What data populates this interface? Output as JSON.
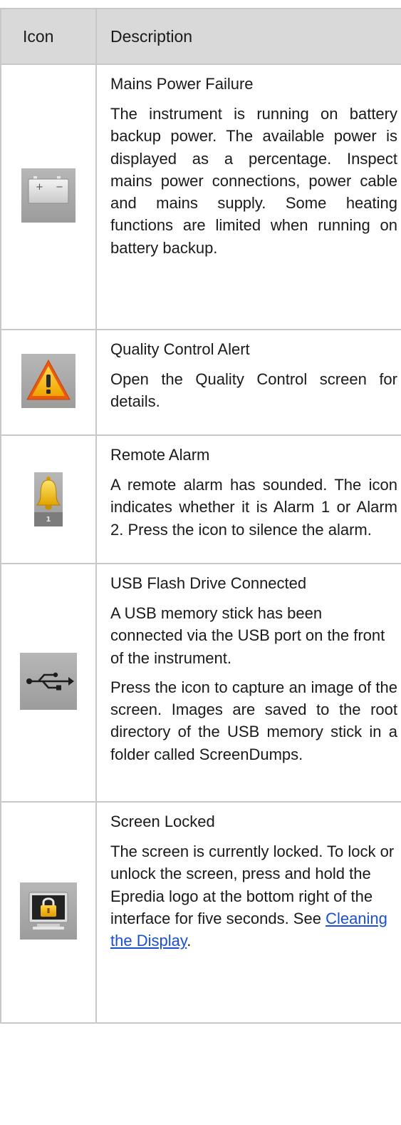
{
  "header": {
    "icon_col": "Icon",
    "desc_col": "Description"
  },
  "rows": [
    {
      "icon": "battery-icon",
      "title": "Mains Power Failure",
      "paragraphs": [
        "The instrument is running on battery backup power. The available power is displayed as a percentage. Inspect mains power connections, power cable and mains supply. Some heating functions are limited when running on battery backup."
      ]
    },
    {
      "icon": "warning-icon",
      "title": "Quality Control Alert",
      "paragraphs": [
        "Open the Quality Control screen for details."
      ]
    },
    {
      "icon": "bell-icon",
      "icon_label": "1",
      "title": "Remote Alarm",
      "paragraphs": [
        "A remote alarm has sounded. The icon indicates whether it is Alarm 1 or Alarm 2. Press the icon to silence the alarm."
      ]
    },
    {
      "icon": "usb-icon",
      "title": "USB Flash Drive Connected",
      "paragraphs": [
        "A USB memory stick has been connected via the USB port on the front of the instrument.",
        "Press the icon to capture an image of the screen. Images are saved to the root directory of the USB memory stick in a folder called ScreenDumps."
      ]
    },
    {
      "icon": "screen-lock-icon",
      "title": "Screen Locked",
      "paragraphs": [
        "The screen is currently locked. To lock or unlock the screen, press and hold the Epredia logo at the bottom right of the interface for five seconds. See"
      ],
      "link_text": "Cleaning the Display",
      "link_suffix": "."
    }
  ],
  "colors": {
    "header_bg": "#d9d9d9",
    "border": "#c8c8c8",
    "link": "#1a4fd1"
  }
}
